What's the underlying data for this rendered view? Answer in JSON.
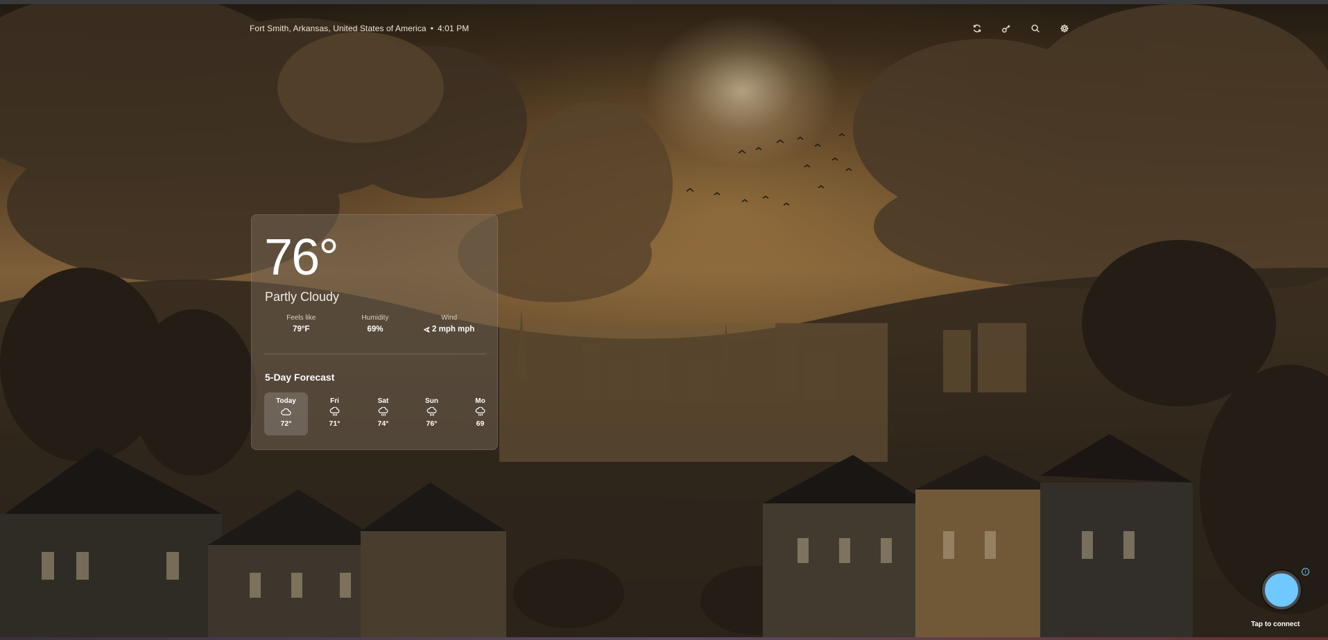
{
  "location": {
    "place": "Fort Smith, Arkansas, United States of America",
    "separator": "•",
    "time": "4:01 PM"
  },
  "toolbar": {
    "icons": [
      "refresh-icon",
      "key-icon",
      "search-icon",
      "settings-icon"
    ]
  },
  "current": {
    "temperature": "76°",
    "condition": "Partly Cloudy",
    "feels_like_label": "Feels like",
    "feels_like_value": "79°F",
    "humidity_label": "Humidity",
    "humidity_value": "69%",
    "wind_label": "Wind",
    "wind_value": "2 mph mph"
  },
  "forecast": {
    "title": "5-Day Forecast",
    "days": [
      {
        "name": "Today",
        "temp": "72°",
        "icon": "cloud-icon"
      },
      {
        "name": "Fri",
        "temp": "71°",
        "icon": "rain-cloud-icon"
      },
      {
        "name": "Sat",
        "temp": "74°",
        "icon": "rain-cloud-icon"
      },
      {
        "name": "Sun",
        "temp": "76°",
        "icon": "rain-cloud-icon"
      },
      {
        "name": "Mo",
        "temp": "69",
        "icon": "rain-cloud-icon"
      }
    ]
  },
  "connect": {
    "label": "Tap to connect",
    "info": "i",
    "color": "#6fc8ff"
  }
}
